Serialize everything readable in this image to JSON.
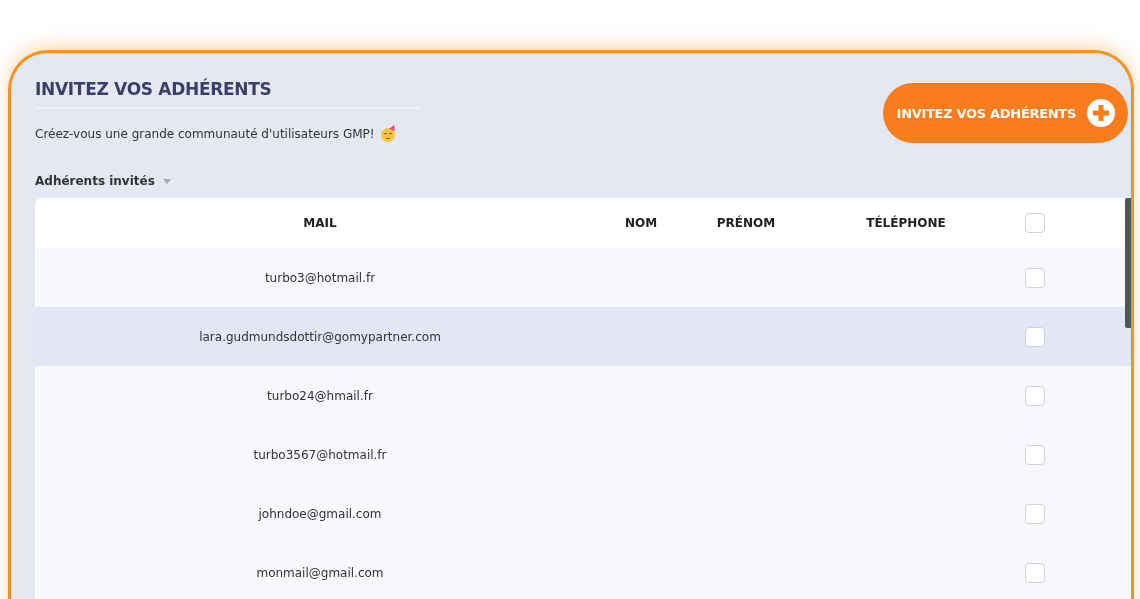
{
  "header": {
    "title": "INVITEZ VOS ADHÉRENTS",
    "subtitle": "Créez-vous une grande communauté d'utilisateurs GMP!",
    "invite_button": "INVITEZ VOS ADHÉRENTS"
  },
  "filter": {
    "label": "Adhérents invités"
  },
  "table": {
    "columns": [
      "MAIL",
      "NOM",
      "PRÉNOM",
      "TÉLÉPHONE"
    ],
    "select_all_checked": false,
    "rows": [
      {
        "mail": "turbo3@hotmail.fr",
        "highlighted": false,
        "checked": false
      },
      {
        "mail": "lara.gudmundsdottir@gomypartner.com",
        "highlighted": true,
        "checked": false
      },
      {
        "mail": "turbo24@hmail.fr",
        "highlighted": false,
        "checked": false
      },
      {
        "mail": "turbo3567@hotmail.fr",
        "highlighted": false,
        "checked": false
      },
      {
        "mail": "johndoe@gmail.com",
        "highlighted": false,
        "checked": false
      },
      {
        "mail": "monmail@gmail.com",
        "highlighted": false,
        "checked": false
      }
    ]
  }
}
